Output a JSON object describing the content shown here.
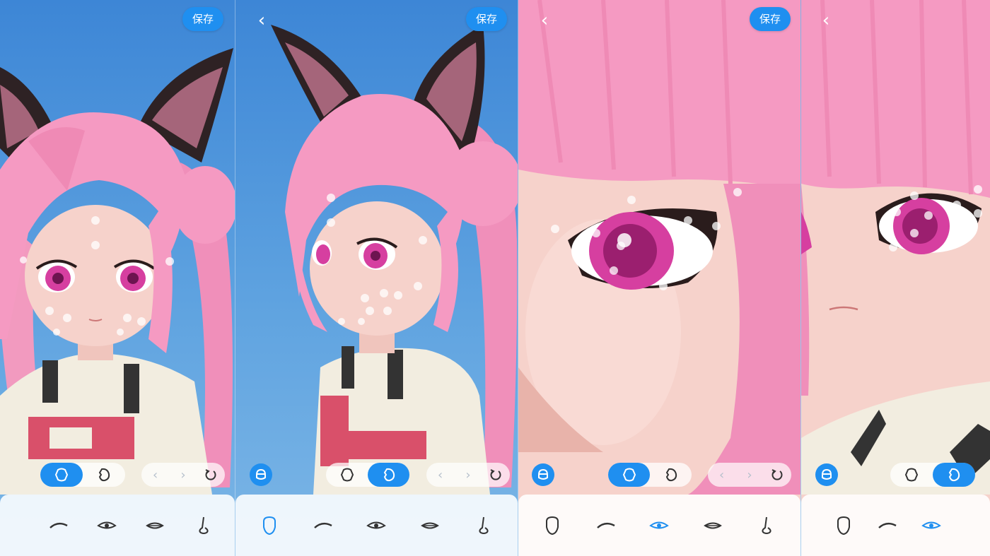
{
  "panels": [
    {
      "save_label": "保存",
      "mode_active": "front",
      "selected_part": "none"
    },
    {
      "save_label": "保存",
      "mode_active": "side",
      "selected_part": "face"
    },
    {
      "save_label": "保存",
      "mode_active": "front",
      "selected_part": "eye"
    },
    {
      "save_label": "",
      "mode_active": "side",
      "selected_part": "eye"
    }
  ],
  "part_categories": [
    "face-shape",
    "eyebrow",
    "eye",
    "mouth",
    "nose"
  ],
  "colors": {
    "accent": "#1f8ff0",
    "background": "#4a8fd4",
    "hair": "#f59ac2",
    "ears": "#3a2a2a",
    "skin": "#f6d2cb",
    "iris": "#d63fa0"
  }
}
